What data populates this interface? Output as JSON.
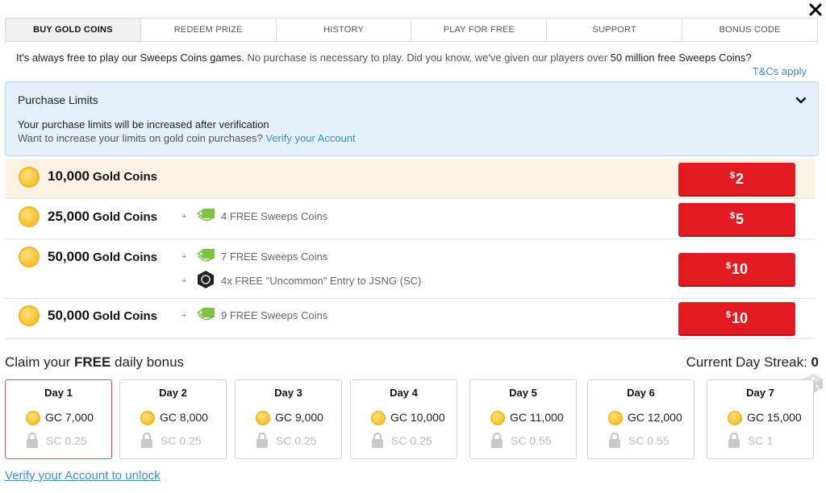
{
  "tabs": [
    {
      "label": "BUY GOLD COINS",
      "active": true
    },
    {
      "label": "REDEEM PRIZE",
      "active": false
    },
    {
      "label": "HISTORY",
      "active": false
    },
    {
      "label": "PLAY FOR FREE",
      "active": false
    },
    {
      "label": "SUPPORT",
      "active": false
    },
    {
      "label": "BONUS CODE",
      "active": false
    }
  ],
  "intro": {
    "part1": "It's always free to play our Sweeps Coins games.",
    "part2": " No purchase is necessary to play. Did you know, we've given our players over ",
    "part3": "50 million free Sweeps Coins?",
    "tcs": "T&Cs apply"
  },
  "limits": {
    "title": "Purchase Limits",
    "line1": "Your purchase limits will be increased after verification",
    "line2": "Want to increase your limits on gold coin purchases?",
    "link": "Verify your Account"
  },
  "packages": [
    {
      "amount": "10,000",
      "unit": "Gold Coins",
      "currency": "$",
      "price": "2",
      "bonuses": []
    },
    {
      "amount": "25,000",
      "unit": "Gold Coins",
      "currency": "$",
      "price": "5",
      "bonuses": [
        {
          "type": "tag",
          "plus": "+",
          "text": "4 FREE Sweeps Coins"
        }
      ]
    },
    {
      "amount": "50,000",
      "unit": "Gold Coins",
      "currency": "$",
      "price": "10",
      "bonuses": [
        {
          "type": "tag",
          "plus": "+",
          "text": "7 FREE Sweeps Coins"
        },
        {
          "type": "hex",
          "plus": "+",
          "text": "4x FREE \"Uncommon\" Entry to JSNG (SC)"
        }
      ]
    },
    {
      "amount": "50,000",
      "unit": "Gold Coins",
      "currency": "$",
      "price": "10",
      "bonuses": [
        {
          "type": "tag",
          "plus": "+",
          "text": "9 FREE Sweeps Coins"
        }
      ]
    }
  ],
  "daily": {
    "claim_prefix": "Claim your ",
    "claim_bold": "FREE",
    "claim_suffix": " daily bonus",
    "streak_label": "Current Day Streak: ",
    "streak_value": "0",
    "days": [
      {
        "title": "Day 1",
        "gc": "GC 7,000",
        "sc": "SC 0.25",
        "active": true
      },
      {
        "title": "Day 2",
        "gc": "GC 8,000",
        "sc": "SC 0.25",
        "active": false
      },
      {
        "title": "Day 3",
        "gc": "GC 9,000",
        "sc": "SC 0.25",
        "active": false
      },
      {
        "title": "Day 4",
        "gc": "GC 10,000",
        "sc": "SC 0.25",
        "active": false
      },
      {
        "title": "Day 5",
        "gc": "GC 11,000",
        "sc": "SC 0.55",
        "active": false
      },
      {
        "title": "Day 6",
        "gc": "GC 12,000",
        "sc": "SC 0.55",
        "active": false
      },
      {
        "title": "Day 7",
        "gc": "GC 15,000",
        "sc": "SC 1",
        "active": false
      }
    ],
    "verify_link": "Verify your Account to unlock"
  },
  "colors": {
    "accent_red": "#e21b23",
    "link_blue": "#3a8fc8",
    "gold": "#f7c43a"
  }
}
